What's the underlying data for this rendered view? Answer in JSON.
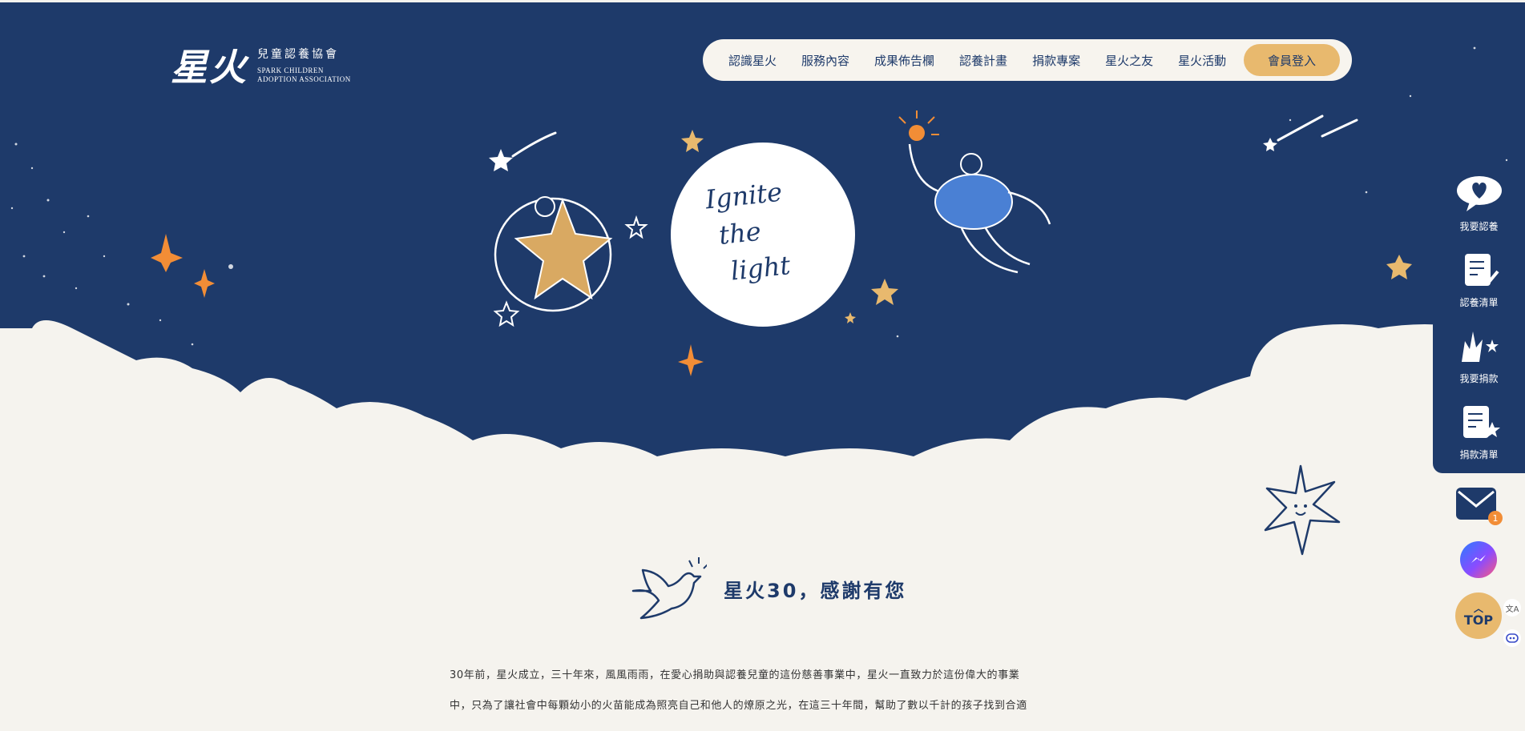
{
  "brand": {
    "logo_mark": "星火",
    "name_zh": "兒童認養協會",
    "name_en_line1": "SPARK CHILDREN",
    "name_en_line2": "ADOPTION ASSOCIATION"
  },
  "nav": {
    "items": [
      "認識星火",
      "服務內容",
      "成果佈告欄",
      "認養計畫",
      "捐款專案",
      "星火之友",
      "星火活動"
    ],
    "login_label": "會員登入"
  },
  "hero": {
    "moon_text_line1": "Ignite",
    "moon_text_line2": "the",
    "moon_text_line3": "light"
  },
  "side_panel": {
    "items": [
      {
        "label": "我要認養",
        "icon": "heart-speech-icon"
      },
      {
        "label": "認養清單",
        "icon": "scroll-check-icon"
      },
      {
        "label": "我要捐款",
        "icon": "stars-hand-icon"
      },
      {
        "label": "捐款清單",
        "icon": "scroll-star-icon"
      }
    ]
  },
  "floating": {
    "mail_badge": "1",
    "top_label": "TOP"
  },
  "section": {
    "title": "星火30，感謝有您",
    "paragraph_line1": "30年前，星火成立，三十年來，風風雨雨，在愛心捐助與認養兒童的這份慈善事業中，星火一直致力於這份偉大的事業",
    "paragraph_line2": "中，只為了讓社會中每顆幼小的火苗能成為照亮自己和他人的燎原之光，在這三十年間，幫助了數以千計的孩子找到合適"
  },
  "colors": {
    "navy": "#1e3a6a",
    "cream": "#f5f3ee",
    "gold": "#e8b96e",
    "orange": "#f28d36"
  }
}
